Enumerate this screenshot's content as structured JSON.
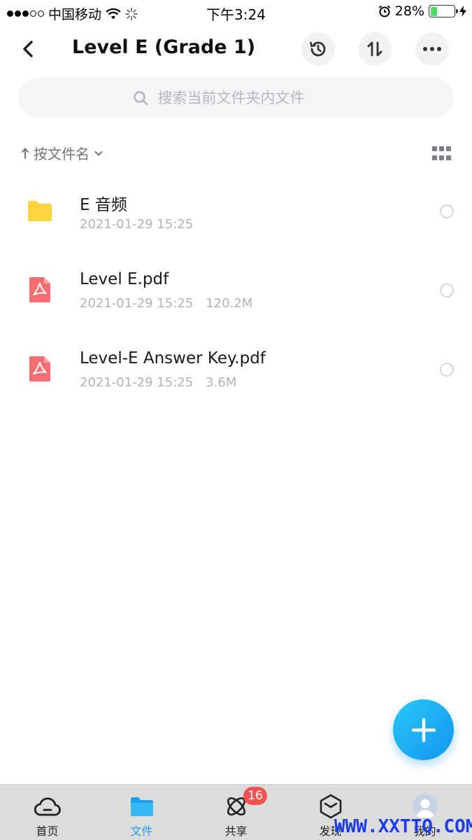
{
  "status_bar": {
    "carrier": "中国移动",
    "time": "下午3:24",
    "battery": "28%",
    "battery_level": 0.28
  },
  "header": {
    "title": "Level E (Grade 1)",
    "back_icon": "chevron-left-icon",
    "history_icon": "history-icon",
    "transfer_icon": "transfer-icon",
    "more_icon": "more-icon"
  },
  "search": {
    "placeholder": "搜索当前文件夹内文件"
  },
  "sort": {
    "label": "按文件名"
  },
  "files": [
    {
      "name": "E 音频",
      "date": "2021-01-29 15:25",
      "size": "",
      "type": "folder"
    },
    {
      "name": "Level E.pdf",
      "date": "2021-01-29 15:25",
      "size": "120.2M",
      "type": "pdf"
    },
    {
      "name": "Level-E Answer Key.pdf",
      "date": "2021-01-29 15:25",
      "size": "3.6M",
      "type": "pdf"
    }
  ],
  "tabs": [
    {
      "label": "首页",
      "icon": "cloud-icon"
    },
    {
      "label": "文件",
      "icon": "folder-icon",
      "active": true
    },
    {
      "label": "共享",
      "icon": "share-orbit-icon",
      "badge": "16"
    },
    {
      "label": "发现",
      "icon": "discover-icon"
    },
    {
      "label": "我的",
      "icon": "avatar"
    }
  ],
  "watermark": "WWW.XXTTQ.COM",
  "colors": {
    "accent": "#1aa0f2",
    "folder": "#ffd640",
    "pdf": "#f56c73",
    "badge": "#f25353"
  }
}
